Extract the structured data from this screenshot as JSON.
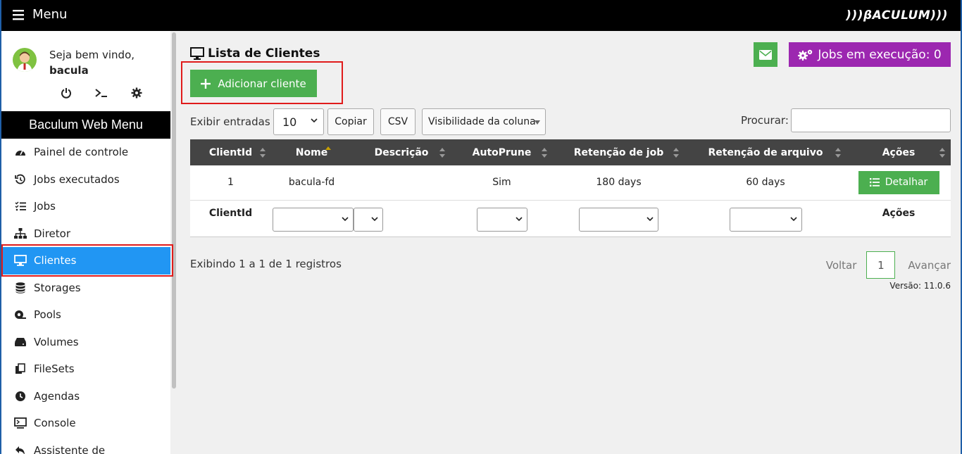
{
  "topbar": {
    "menu_label": "Menu",
    "logo": ")))βACULUM)))"
  },
  "user": {
    "greeting": "Seja bem vindo,",
    "name": "bacula"
  },
  "sidebar": {
    "title": "Baculum Web Menu",
    "items": [
      {
        "label": "Painel de controle",
        "icon": "dashboard-icon"
      },
      {
        "label": "Jobs executados",
        "icon": "history-icon"
      },
      {
        "label": "Jobs",
        "icon": "tasks-icon"
      },
      {
        "label": "Diretor",
        "icon": "sitemap-icon"
      },
      {
        "label": "Clientes",
        "icon": "desktop-icon",
        "active": true
      },
      {
        "label": "Storages",
        "icon": "database-icon"
      },
      {
        "label": "Pools",
        "icon": "tape-icon"
      },
      {
        "label": "Volumes",
        "icon": "hdd-icon"
      },
      {
        "label": "FileSets",
        "icon": "copy-icon"
      },
      {
        "label": "Agendas",
        "icon": "clock-icon"
      },
      {
        "label": "Console",
        "icon": "terminal-icon"
      },
      {
        "label": "Assistente de",
        "icon": "reply-icon"
      }
    ]
  },
  "main": {
    "title": "Lista de Clientes",
    "add_button": "Adicionar cliente",
    "jobs_running": "Jobs em execução: 0",
    "show_entries_label": "Exibir entradas",
    "show_entries_value": "10",
    "copy_button": "Copiar",
    "csv_button": "CSV",
    "column_visibility": "Visibilidade da coluna",
    "search_label": "Procurar:",
    "search_value": "",
    "table": {
      "headers": [
        "ClientId",
        "Nome",
        "Descrição",
        "AutoPrune",
        "Retenção de job",
        "Retenção de arquivo",
        "Ações"
      ],
      "rows": [
        {
          "clientid": "1",
          "nome": "bacula-fd",
          "descricao": "",
          "autoprune": "Sim",
          "job_retention": "180 days",
          "file_retention": "60 days",
          "action": "Detalhar"
        }
      ],
      "footer": {
        "clientid": "ClientId",
        "acoes": "Ações"
      }
    },
    "info": "Exibindo 1 a 1 de 1 registros",
    "pager": {
      "prev": "Voltar",
      "current": "1",
      "next": "Avançar"
    },
    "version": "Versão: 11.0.6"
  },
  "colors": {
    "accent_blue": "#2196f3",
    "green": "#4caf50",
    "purple": "#9c27b0",
    "header_dark": "#444444"
  }
}
